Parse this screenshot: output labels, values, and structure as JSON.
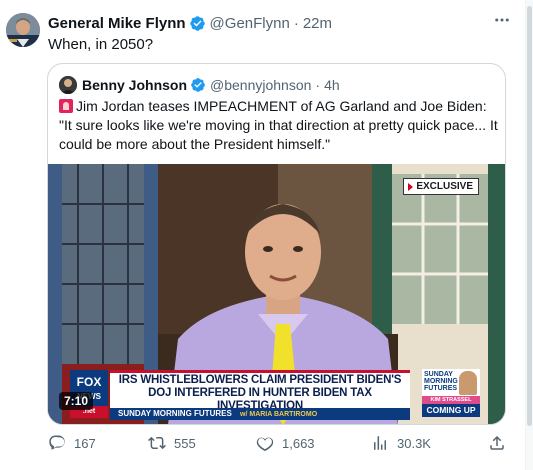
{
  "tweet": {
    "author_name": "General Mike Flynn",
    "author_handle": "@GenFlynn",
    "separator": "·",
    "time": "22m",
    "text": "When, in 2050?",
    "avatar_icon": "avatar-photo",
    "more_icon": "more-icon"
  },
  "quote": {
    "author_name": "Benny Johnson",
    "author_handle": "@bennyjohnson",
    "separator": "·",
    "time": "4h",
    "text": "Jim Jordan teases IMPEACHMENT of AG Garland and Joe Biden: \"It sure looks like we're moving in that direction at pretty quick pace... It could be more about the President himself.\"",
    "video": {
      "exclusive_badge": "EXCLUSIVE",
      "channel_logo_line1": "FOX",
      "channel_logo_line2": "NEWS",
      "channel_logo_line3": ".net",
      "chyron_headline": "IRS WHISTLEBLOWERS CLAIM PRESIDENT BIDEN'S DOJ INTERFERED IN HUNTER BIDEN TAX INVESTIGATION",
      "chyron_show": "SUNDAY MORNING FUTURES",
      "chyron_host": "w/ MARIA BARTIROMO",
      "promo_title": "SUNDAY MORNING FUTURES",
      "promo_host": "KIM STRASSEL",
      "promo_coming": "COMING UP",
      "timestamp": "7:10"
    }
  },
  "actions": {
    "replies": "167",
    "retweets": "555",
    "likes": "1,663",
    "views": "30.3K"
  },
  "colors": {
    "verified_blue": "#1d9bf0",
    "secondary_text": "#536471",
    "border": "#cfd9de"
  }
}
